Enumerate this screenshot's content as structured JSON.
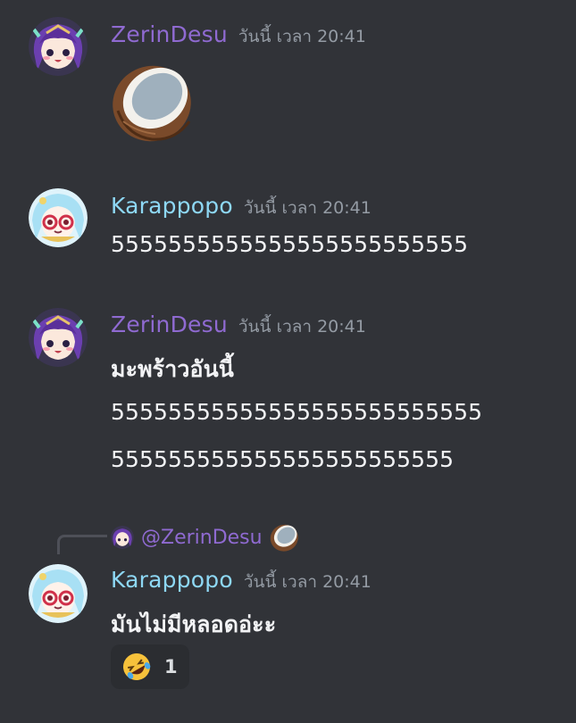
{
  "messages": [
    {
      "author": "ZerinDesu",
      "timestamp": "วันนี้ เวลา 20:41",
      "avatar_icon": "zerin-avatar-icon",
      "content_emoji": "coconut-icon"
    },
    {
      "author": "Karappopo",
      "timestamp": "วันนี้ เวลา 20:41",
      "avatar_icon": "karappopo-avatar-icon",
      "lines": [
        "5555555555555555555555555"
      ]
    },
    {
      "author": "ZerinDesu",
      "timestamp": "วันนี้ เวลา 20:41",
      "avatar_icon": "zerin-avatar-icon",
      "lines": [
        "มะพร้าวอันนี้",
        "55555555555555555555555555",
        "555555555555555555555555"
      ]
    },
    {
      "author": "Karappopo",
      "timestamp": "วันนี้ เวลา 20:41",
      "avatar_icon": "karappopo-avatar-icon",
      "reply_to": "@ZerinDesu",
      "reply_emoji": "coconut-icon",
      "lines": [
        "มันไม่มีหลอดอ่ะะ"
      ],
      "reaction": {
        "emoji": "rolling-on-floor-laughing-icon",
        "count": "1"
      }
    }
  ],
  "colors": {
    "background": "#313338",
    "zerin_name": "#8f6ad1",
    "karappopo_name": "#8ed8f5",
    "timestamp": "#949ba4",
    "text": "#f2f3f5",
    "reaction_bg": "#2b2d31"
  }
}
